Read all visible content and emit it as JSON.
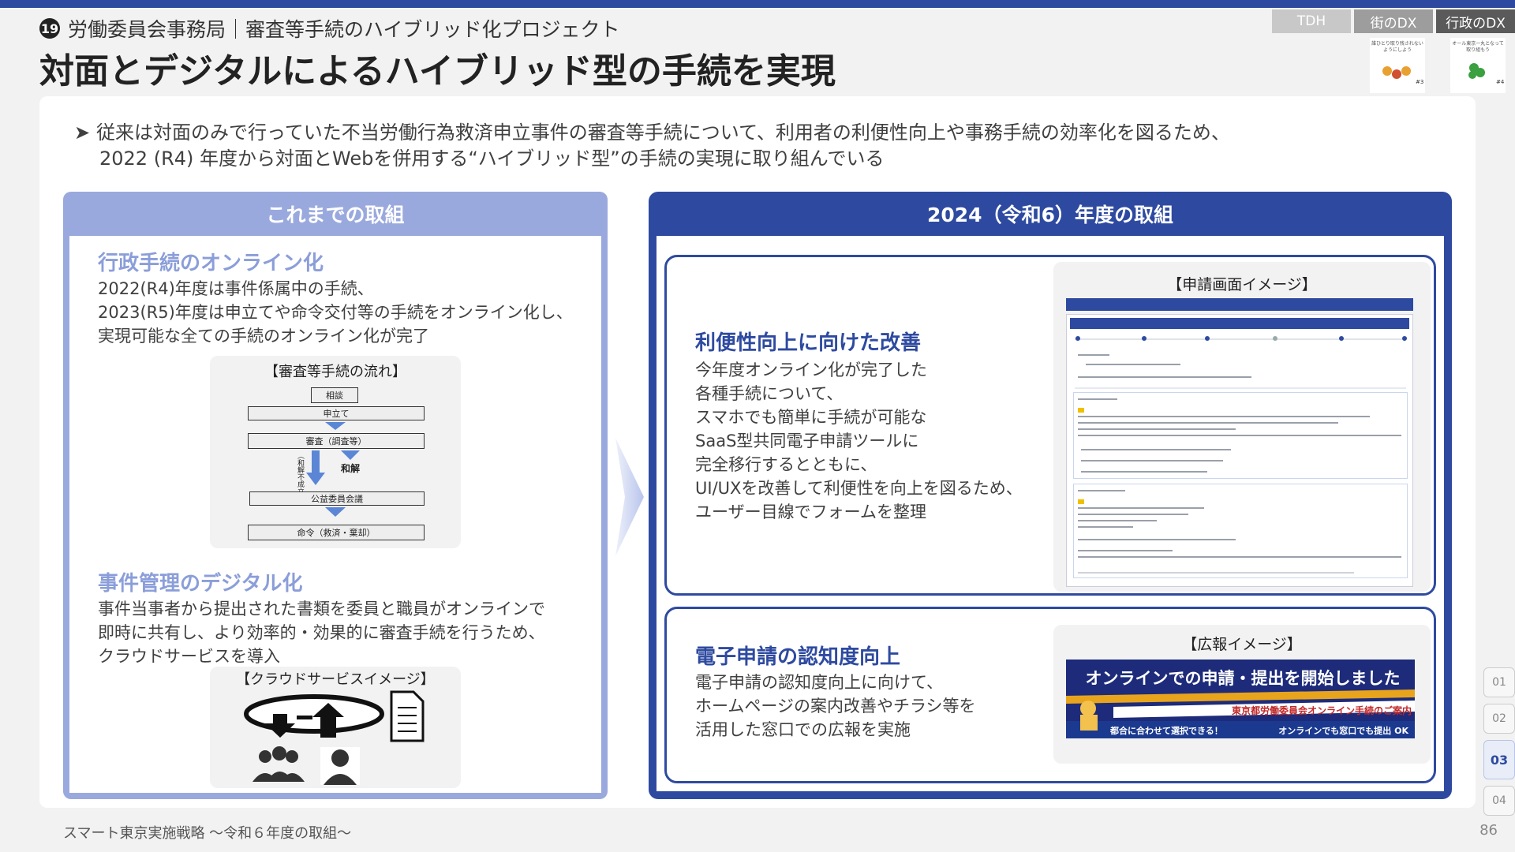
{
  "header": {
    "badge": "⑲",
    "subtitle": "労働委員会事務局｜審査等手続のハイブリッド化プロジェクト",
    "title": "対面とデジタルによるハイブリッド型の手続を実現"
  },
  "tags": [
    "TDH",
    "街のDX",
    "行政のDX"
  ],
  "tag_logos": [
    {
      "tiny": "誰ひとり取り残されないようにしよう",
      "num": "#3"
    },
    {
      "tiny": "オール東京一丸となって取り組もう",
      "num": "#4"
    }
  ],
  "intro": {
    "bullet": "➤",
    "line1": "従来は対面のみで行っていた不当労働行為救済申立事件の審査等手続について、利用者の利便性向上や事務手続の効率化を図るため、",
    "line2": "2022 (R4) 年度から対面とWebを併用する“ハイブリッド型”の手続の実現に取り組んでいる"
  },
  "left_panel": {
    "heading": "これまでの取組",
    "section1": {
      "title": "行政手続のオンライン化",
      "lines": [
        "2022(R4)年度は事件係属中の手続、",
        "2023(R5)年度は申立てや命令交付等の手続をオンライン化し、",
        "実現可能な全ての手続のオンライン化が完了"
      ]
    },
    "flow": {
      "title": "【審査等手続の流れ】",
      "steps": [
        "相談",
        "申立て",
        "審査（調査等）",
        "公益委員会議",
        "命令（救済・棄却）"
      ],
      "side_label": "和解",
      "vertical_label": "（和解不成立）"
    },
    "section2": {
      "title": "事件管理のデジタル化",
      "lines": [
        "事件当事者から提出された書類を委員と職員がオンラインで",
        "即時に共有し、より効率的・効果的に審査手続を行うため、",
        "クラウドサービスを導入"
      ]
    },
    "cloud": {
      "title": "【クラウドサービスイメージ】"
    }
  },
  "right_panel": {
    "heading": "2024（令和6）年度の取組",
    "card1": {
      "title": "利便性向上に向けた改善",
      "lines": [
        "今年度オンライン化が完了した",
        "各種手続について、",
        "スマホでも簡単に手続が可能な",
        "SaaS型共同電子申請ツールに",
        "完全移行するとともに、",
        "UI/UXを改善して利便性を向上を図るため、",
        "ユーザー目線でフォームを整理"
      ],
      "image_title": "【申請画面イメージ】"
    },
    "card2": {
      "title": "電子申請の認知度向上",
      "lines": [
        "電子申請の認知度向上に向けて、",
        "ホームページの案内改善やチラシ等を",
        "活用した窓口での広報を実施"
      ],
      "image_title": "【広報イメージ】",
      "banner": {
        "headline": "オンラインでの申請・提出を開始しました",
        "subline": "東京都労働委員会オンライン手続のご案内",
        "foot_left": "都合に合わせて選択できる！",
        "foot_right": "オンラインでも窓口でも提出 OK"
      }
    }
  },
  "pager": [
    "01",
    "02",
    "03",
    "04"
  ],
  "pager_active": "03",
  "footer": "スマート東京実施戦略 〜令和６年度の取組〜",
  "page_number": "86",
  "colors": {
    "brand_blue": "#2e4aa0",
    "light_blue": "#9aa9dd",
    "accent_text": "#8b9ed9"
  }
}
